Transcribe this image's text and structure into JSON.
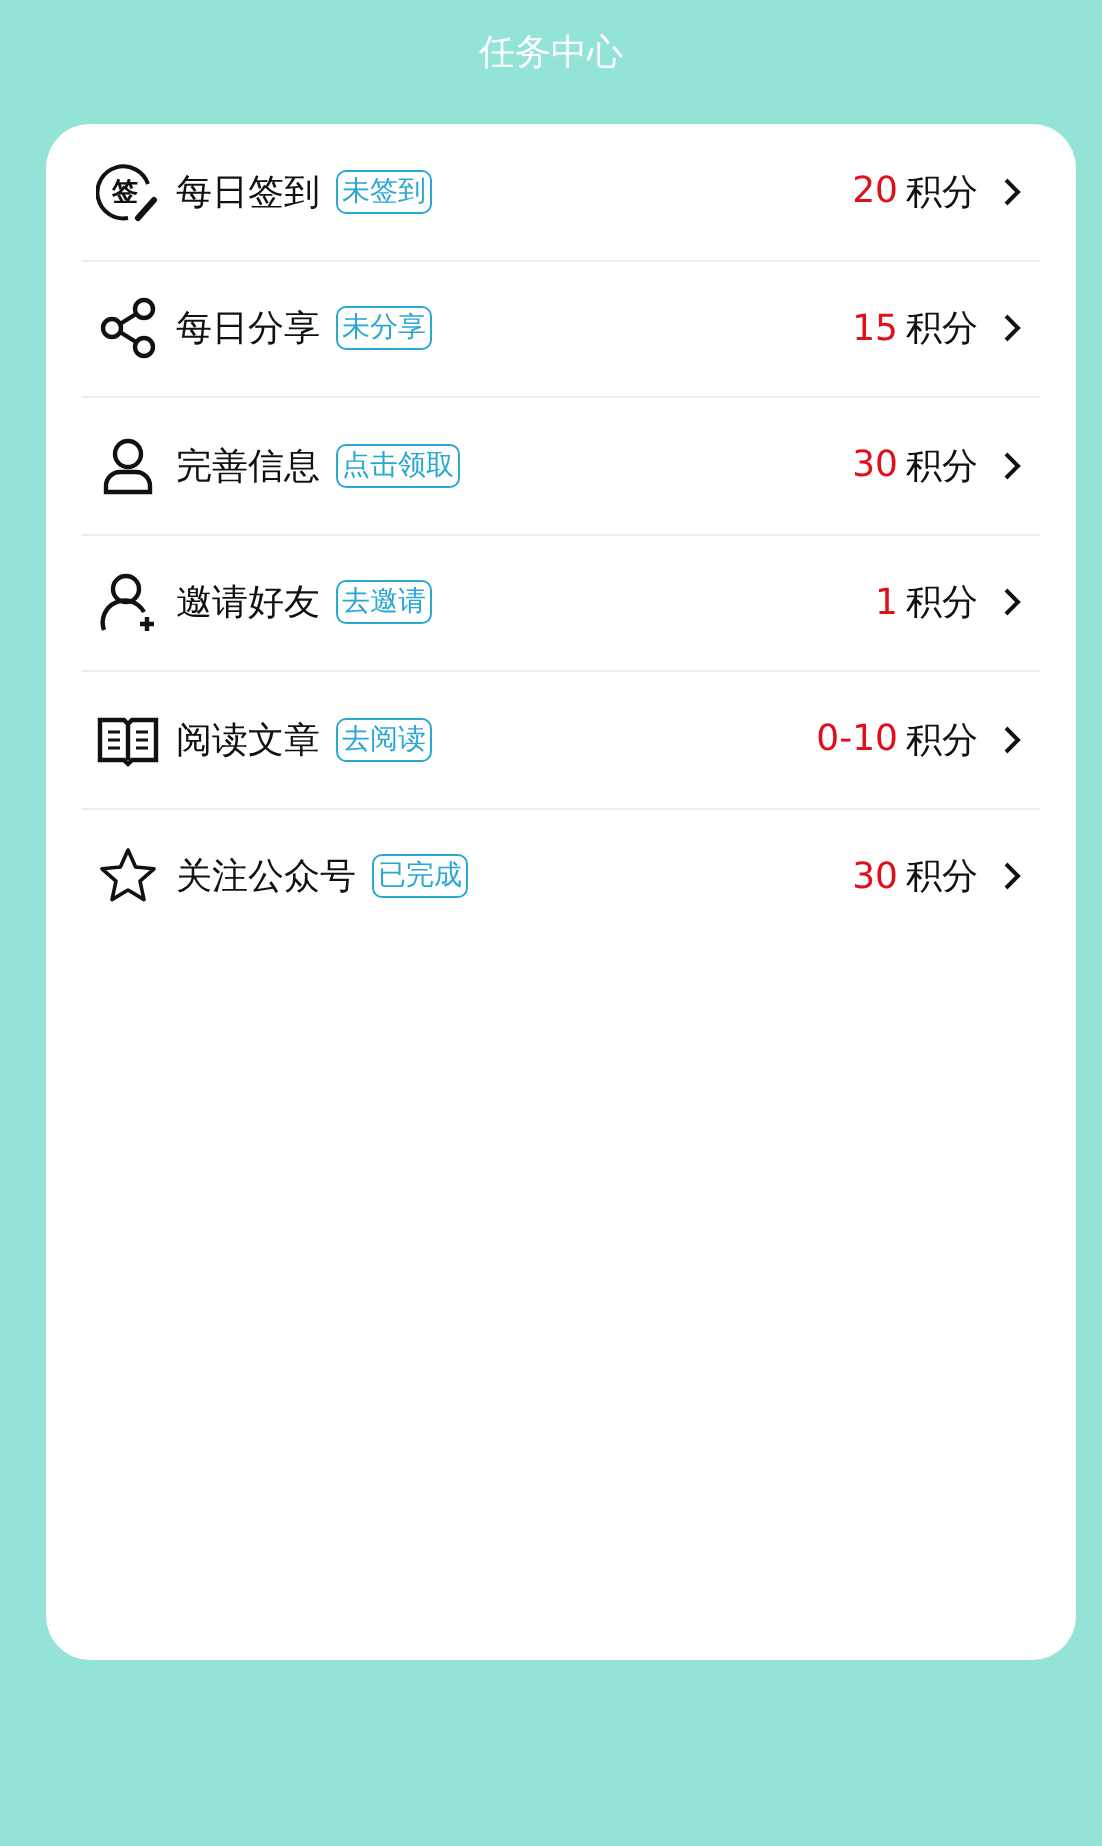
{
  "header": {
    "title": "任务中心"
  },
  "tasks": [
    {
      "icon_text": "签",
      "label": "每日签到",
      "tag": "未签到",
      "points": "20",
      "unit": "积分"
    },
    {
      "label": "每日分享",
      "tag": "未分享",
      "points": "15",
      "unit": "积分"
    },
    {
      "label": "完善信息",
      "tag": "点击领取",
      "points": "30",
      "unit": "积分"
    },
    {
      "label": "邀请好友",
      "tag": "去邀请",
      "points": "1",
      "unit": "积分"
    },
    {
      "label": "阅读文章",
      "tag": "去阅读",
      "points": "0-10",
      "unit": "积分"
    },
    {
      "label": "关注公众号",
      "tag": "已完成",
      "points": "30",
      "unit": "积分"
    }
  ]
}
